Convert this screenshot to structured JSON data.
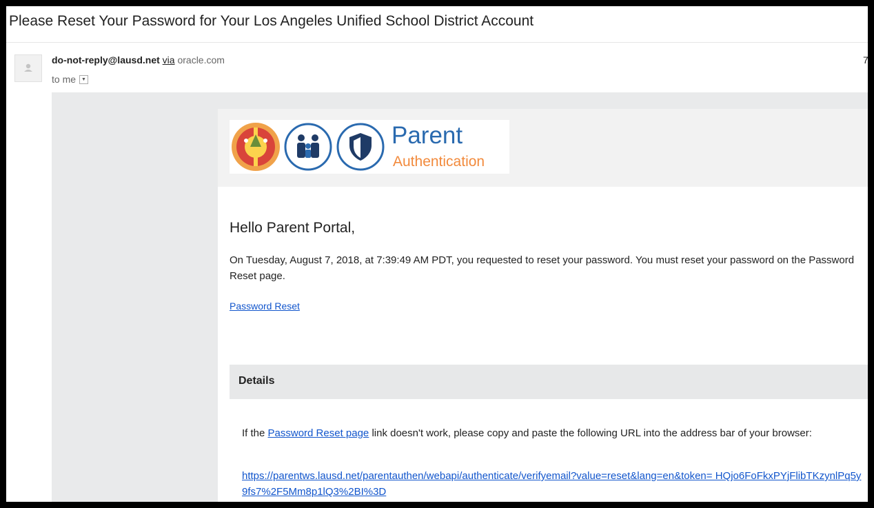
{
  "email": {
    "subject": "Please Reset Your Password for Your Los Angeles Unified School District Account",
    "sender": {
      "address": "do-not-reply@lausd.net",
      "via_label": "via",
      "via_domain": "oracle.com",
      "recipient": "to me",
      "time_fragment": "7"
    },
    "logo": {
      "title": "Parent",
      "subtitle": "Authentication",
      "colors": {
        "blue": "#2a6aaf",
        "orange": "#f28a3c"
      }
    },
    "greeting": "Hello Parent Portal,",
    "body_text": "On Tuesday, August 7, 2018, at 7:39:49 AM PDT, you requested to reset your password. You must reset your password on the Password Reset page.",
    "reset_link_label": "Password Reset",
    "details": {
      "title": "Details",
      "text_before": "If the ",
      "inline_link": "Password Reset page",
      "text_after": " link doesn't work, please copy and paste the following URL into the address bar of your browser:",
      "url": "https://parentws.lausd.net/parentauthen/webapi/authenticate/verifyemail?value=reset&lang=en&token= HQjo6FoFkxPYjFlibTKzynlPq5y9fs7%2F5Mm8p1lQ3%2BI%3D"
    }
  }
}
